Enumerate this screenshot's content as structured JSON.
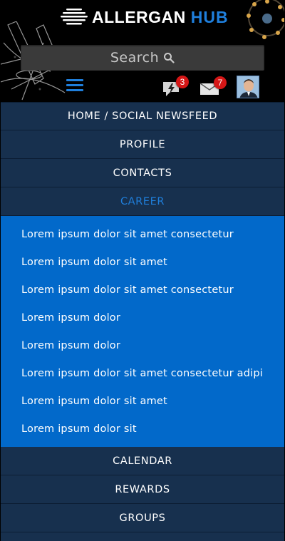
{
  "header": {
    "logo_main": "ALLERGAN",
    "logo_hub": "HUB",
    "search_placeholder": "Search",
    "alerts_count": "3",
    "messages_count": "7"
  },
  "colors": {
    "accent": "#1f7fdc",
    "nav_bg": "#17304e",
    "submenu_bg": "#0269ca",
    "badge": "#d51616"
  },
  "nav": {
    "top_items": [
      {
        "label": "HOME / SOCIAL NEWSFEED"
      },
      {
        "label": "PROFILE"
      },
      {
        "label": "CONTACTS"
      },
      {
        "label": "CAREER"
      }
    ],
    "career_submenu": [
      {
        "label": "Lorem ipsum dolor sit amet consectetur"
      },
      {
        "label": "Lorem ipsum dolor sit amet"
      },
      {
        "label": "Lorem ipsum dolor sit amet consectetur"
      },
      {
        "label": "Lorem ipsum dolor"
      },
      {
        "label": "Lorem ipsum dolor"
      },
      {
        "label": "Lorem ipsum dolor sit amet consectetur adipi"
      },
      {
        "label": "Lorem ipsum dolor sit amet"
      },
      {
        "label": "Lorem ipsum dolor sit"
      }
    ],
    "bottom_items": [
      {
        "label": "CALENDAR"
      },
      {
        "label": "REWARDS"
      },
      {
        "label": "GROUPS"
      }
    ]
  }
}
